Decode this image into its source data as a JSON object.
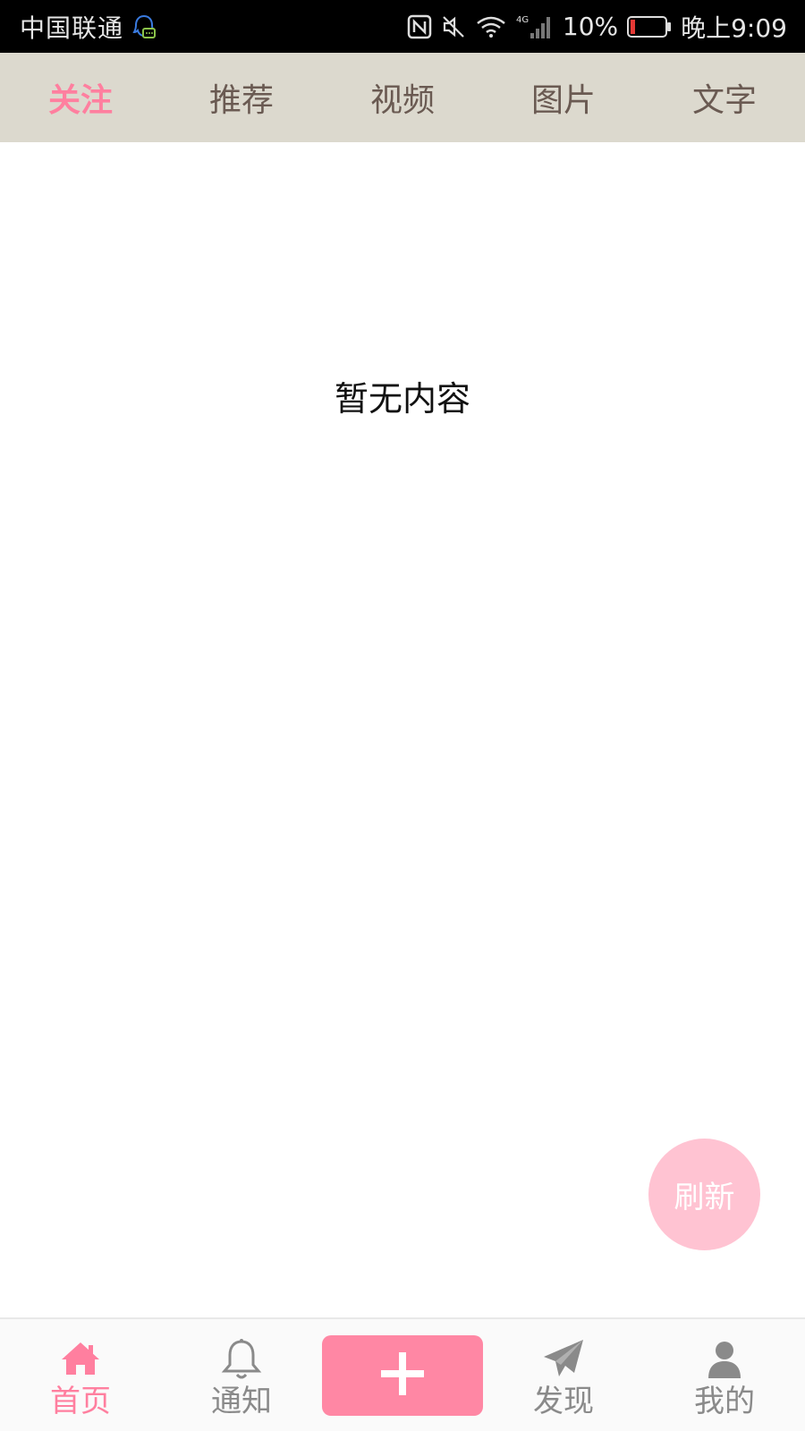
{
  "status_bar": {
    "carrier": "中国联通",
    "battery_percent": "10%",
    "time": "晚上9:09",
    "icons": [
      "qq-notification-icon",
      "nfc-icon",
      "mute-icon",
      "wifi-icon",
      "signal-4g-icon",
      "battery-icon"
    ]
  },
  "top_tabs": [
    {
      "label": "关注",
      "active": true
    },
    {
      "label": "推荐",
      "active": false
    },
    {
      "label": "视频",
      "active": false
    },
    {
      "label": "图片",
      "active": false
    },
    {
      "label": "文字",
      "active": false
    }
  ],
  "content": {
    "empty_message": "暂无内容"
  },
  "refresh_button": {
    "label": "刷新"
  },
  "bottom_nav": {
    "items": [
      {
        "label": "首页",
        "icon": "home-icon",
        "active": true
      },
      {
        "label": "通知",
        "icon": "bell-icon",
        "active": false
      },
      {
        "label": "",
        "icon": "plus-icon",
        "active": false
      },
      {
        "label": "发现",
        "icon": "paper-plane-icon",
        "active": false
      },
      {
        "label": "我的",
        "icon": "user-icon",
        "active": false
      }
    ]
  },
  "colors": {
    "accent": "#ff7f9f",
    "add_button": "#ff87a4",
    "refresh_button": "#ffc3d2",
    "top_tab_bg": "#dcd9ce",
    "top_tab_text": "#6a5a52",
    "nav_inactive": "#8a8a8a"
  }
}
